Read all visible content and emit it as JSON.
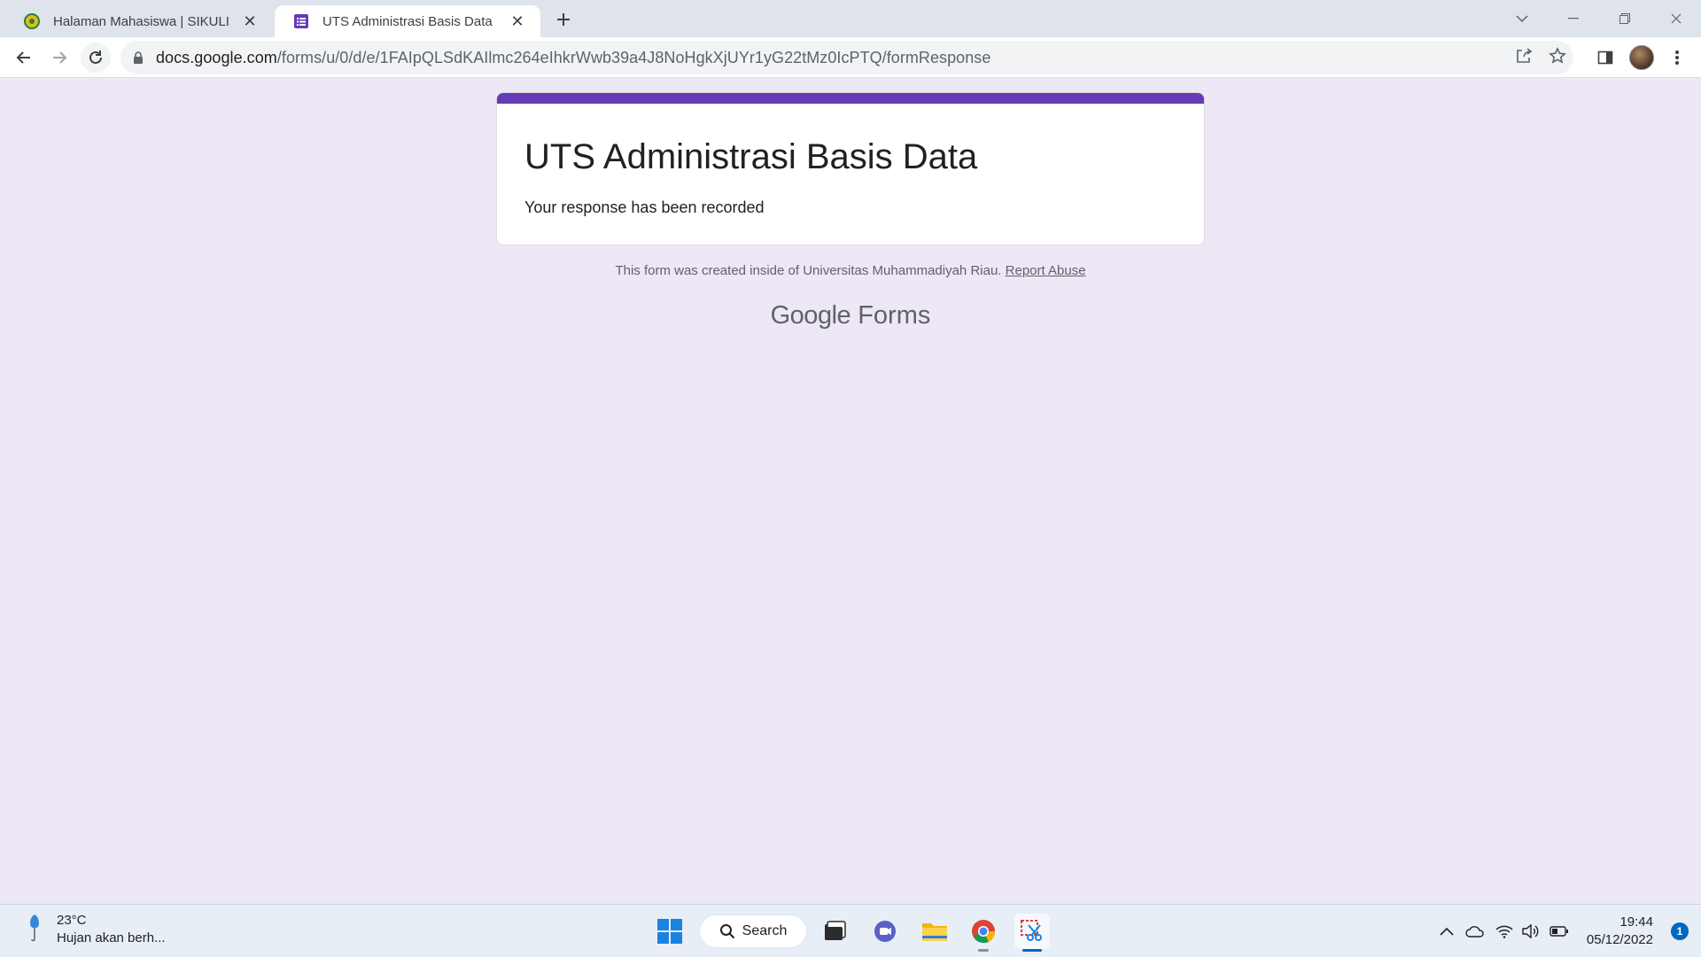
{
  "browser": {
    "tabs": [
      {
        "title": "Halaman Mahasiswa | SIKULI",
        "favicon": "university-seal-icon",
        "active": false
      },
      {
        "title": "UTS Administrasi Basis Data",
        "favicon": "google-forms-icon",
        "active": true
      }
    ],
    "new_tab_icon": "plus-icon",
    "address": {
      "host": "docs.google.com",
      "path": "/forms/u/0/d/e/1FAIpQLSdKAIlmc264eIhkrWwb39a4J8NoHgkXjUYr1yG22tMz0IcPTQ/formResponse"
    }
  },
  "form": {
    "accent_color": "#673ab7",
    "title": "UTS Administrasi Basis Data",
    "confirmation": "Your response has been recorded",
    "footer_text": "This form was created inside of Universitas Muhammadiyah Riau.",
    "report_link": "Report Abuse",
    "brand_google": "Google",
    "brand_forms": "Forms"
  },
  "taskbar": {
    "weather_temp": "23°C",
    "weather_desc": "Hujan akan berh...",
    "search_label": "Search",
    "time": "19:44",
    "date": "05/12/2022",
    "notification_count": "1"
  }
}
